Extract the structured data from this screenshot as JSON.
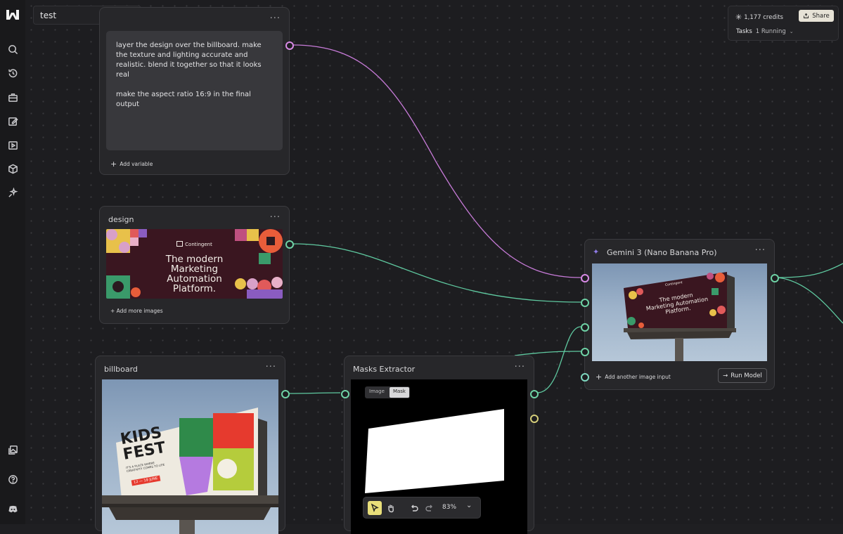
{
  "project": {
    "title": "test"
  },
  "sidebar": {
    "icons": [
      "search-icon",
      "history-icon",
      "briefcase-icon",
      "edit-icon",
      "video-icon",
      "cube-icon",
      "sparkle-wand-icon",
      "gallery-icon",
      "help-icon",
      "discord-icon"
    ]
  },
  "header": {
    "credits": "1,177 credits",
    "share_label": "Share",
    "tasks_label": "Tasks",
    "tasks_status": "1 Running"
  },
  "prompt_node": {
    "text_1": "layer the design over the billboard. make the texture and lighting accurate and realistic. blend it together so that it looks real",
    "text_2": "make the aspect ratio 16:9 in the final output",
    "add_variable": "Add variable"
  },
  "design_node": {
    "title": "design",
    "banner_logo": "Contingent",
    "banner_text": "The modern Marketing Automation Platform.",
    "add_more": "+ Add more images"
  },
  "billboard_node": {
    "title": "billboard",
    "poster_line1": "KIDS",
    "poster_line2": "FEST",
    "poster_sub": "IT'S A PLACE WHERE CREATIVITY COMES TO LIFE",
    "poster_date": "12 — 19 JUNE"
  },
  "masks_node": {
    "title": "Masks Extractor",
    "tabs": [
      "Image",
      "Mask"
    ],
    "active_tab": "Mask",
    "zoom": "83%"
  },
  "gemini_node": {
    "title": "Gemini 3 (Nano Banana Pro)",
    "add_input": "Add another image input",
    "run_label": "Run Model",
    "output_logo": "Contingent",
    "output_text": "The modern Marketing Automation Platform."
  },
  "colors": {
    "edge_pink": "#c77bd8",
    "edge_green": "#5fc9a0",
    "banner_bg": "#3a1620",
    "share_bg": "#e6e2d6"
  }
}
